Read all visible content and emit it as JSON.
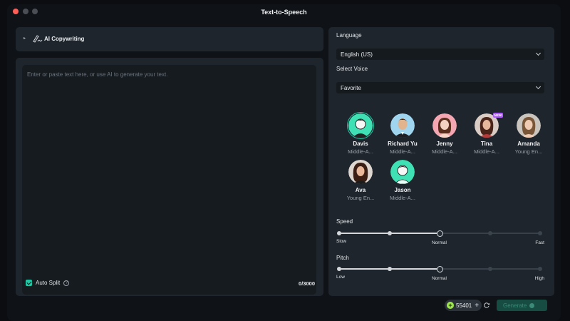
{
  "window": {
    "title": "Text-to-Speech"
  },
  "copywriting": {
    "label": "AI Copywriting",
    "expand_icon": "triangle-right-icon",
    "icon": "pen-ai-icon"
  },
  "editor": {
    "placeholder": "Enter or paste text here, or use AI to generate your text.",
    "value": "",
    "auto_split_label": "Auto Split",
    "auto_split_checked": true,
    "char_count": "0/3000"
  },
  "language": {
    "label": "Language",
    "selected": "English (US)"
  },
  "voice_select": {
    "label": "Select Voice",
    "selected": "Favorite"
  },
  "voices": [
    {
      "name": "Davis",
      "desc": "Middle-A...",
      "selected": true,
      "badge": ""
    },
    {
      "name": "Richard Yu",
      "desc": "Middle-A...",
      "selected": false,
      "badge": ""
    },
    {
      "name": "Jenny",
      "desc": "Middle-A...",
      "selected": false,
      "badge": ""
    },
    {
      "name": "Tina",
      "desc": "Middle-A...",
      "selected": false,
      "badge": "NEW"
    },
    {
      "name": "Amanda",
      "desc": "Young En...",
      "selected": false,
      "badge": ""
    },
    {
      "name": "Ava",
      "desc": "Young En...",
      "selected": false,
      "badge": ""
    },
    {
      "name": "Jason",
      "desc": "Middle-A...",
      "selected": false,
      "badge": ""
    }
  ],
  "speed": {
    "label": "Speed",
    "min_label": "Slow",
    "mid_label": "Normal",
    "max_label": "Fast",
    "steps": 5,
    "value_index": 2
  },
  "pitch": {
    "label": "Pitch",
    "min_label": "Low",
    "mid_label": "Normal",
    "max_label": "High",
    "steps": 5,
    "value_index": 2
  },
  "footer": {
    "credits": "55401",
    "generate_label": "Generate"
  },
  "colors": {
    "accent": "#1ec8a5",
    "panel": "#1e252c",
    "background": "#0f1216",
    "new_badge": "#b05cff"
  }
}
